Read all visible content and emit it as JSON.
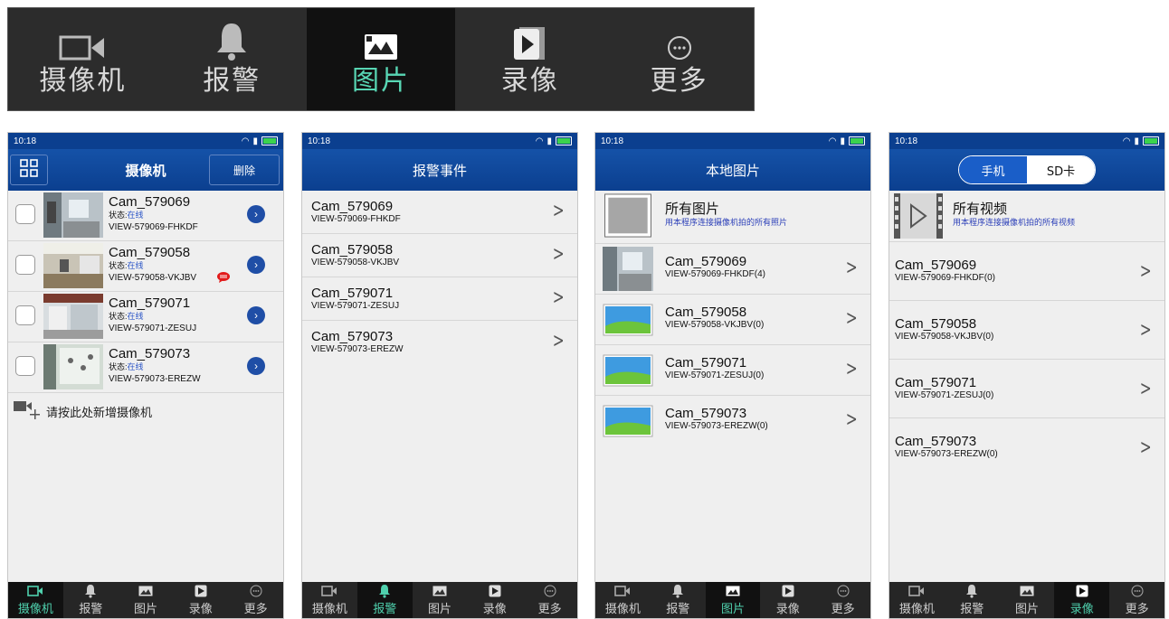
{
  "tabs": [
    {
      "label": "摄像机",
      "icon": "video-camera-icon"
    },
    {
      "label": "报警",
      "icon": "bell-icon"
    },
    {
      "label": "图片",
      "icon": "picture-icon"
    },
    {
      "label": "录像",
      "icon": "play-video-icon"
    },
    {
      "label": "更多",
      "icon": "more-icon"
    }
  ],
  "status": {
    "time": "10:18"
  },
  "screen1": {
    "title": "摄像机",
    "delete_label": "删除",
    "status_prefix": "状态:",
    "status_value": "在线",
    "cameras": [
      {
        "name": "Cam_579069",
        "id": "VIEW-579069-FHKDF"
      },
      {
        "name": "Cam_579058",
        "id": "VIEW-579058-VKJBV"
      },
      {
        "name": "Cam_579071",
        "id": "VIEW-579071-ZESUJ"
      },
      {
        "name": "Cam_579073",
        "id": "VIEW-579073-EREZW"
      }
    ],
    "add_label": "请按此处新增摄像机"
  },
  "screen2": {
    "title": "报警事件",
    "events": [
      {
        "name": "Cam_579069",
        "id": "VIEW-579069-FHKDF"
      },
      {
        "name": "Cam_579058",
        "id": "VIEW-579058-VKJBV"
      },
      {
        "name": "Cam_579071",
        "id": "VIEW-579071-ZESUJ"
      },
      {
        "name": "Cam_579073",
        "id": "VIEW-579073-EREZW"
      }
    ]
  },
  "screen3": {
    "title": "本地图片",
    "all_title": "所有图片",
    "all_sub": "用本程序连接摄像机拍的所有照片",
    "items": [
      {
        "name": "Cam_579069",
        "id": "VIEW-579069-FHKDF(4)"
      },
      {
        "name": "Cam_579058",
        "id": "VIEW-579058-VKJBV(0)"
      },
      {
        "name": "Cam_579071",
        "id": "VIEW-579071-ZESUJ(0)"
      },
      {
        "name": "Cam_579073",
        "id": "VIEW-579073-EREZW(0)"
      }
    ]
  },
  "screen4": {
    "seg_phone": "手机",
    "seg_sd": "SD卡",
    "all_title": "所有视频",
    "all_sub": "用本程序连接摄像机拍的所有视频",
    "items": [
      {
        "name": "Cam_579069",
        "id": "VIEW-579069-FHKDF(0)"
      },
      {
        "name": "Cam_579058",
        "id": "VIEW-579058-VKJBV(0)"
      },
      {
        "name": "Cam_579071",
        "id": "VIEW-579071-ZESUJ(0)"
      },
      {
        "name": "Cam_579073",
        "id": "VIEW-579073-EREZW(0)"
      }
    ]
  },
  "colors": {
    "titlebar": "#0b3f8f",
    "tab_active": "#4fd0ad",
    "status_online": "#2b55c7",
    "alert": "#e21a1a"
  }
}
